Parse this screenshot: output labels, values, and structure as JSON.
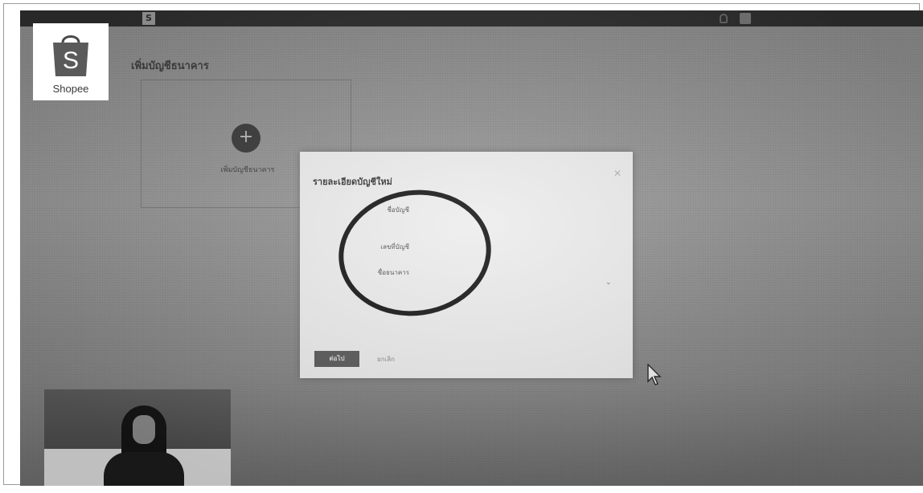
{
  "logo": {
    "brand": "Shopee",
    "bag_letter": "S"
  },
  "top_bar": {
    "app_letter": "S",
    "app_title": "",
    "user_name": ""
  },
  "page": {
    "title": "เพิ่มบัญชีธนาคาร",
    "add_label": "เพิ่มบัญชีธนาคาร"
  },
  "modal": {
    "title": "รายละเอียดบัญชีใหม่",
    "field_1_label": "ชื่อบัญชี",
    "field_2_label": "เลขที่บัญชี",
    "field_3_label": "ชื่อธนาคาร",
    "note": "",
    "save_label": "ต่อไป",
    "cancel_label": "ยกเลิก",
    "terms_label": ""
  },
  "colors": {
    "oval": "#1a1a1a",
    "modal_bg": "#ededed",
    "screen_bg": "#929292"
  },
  "icons": [
    "add-circle-icon",
    "close-icon",
    "chevron-down-icon",
    "cursor-icon",
    "bell-icon",
    "profile-icon",
    "shopee-bag-icon"
  ]
}
